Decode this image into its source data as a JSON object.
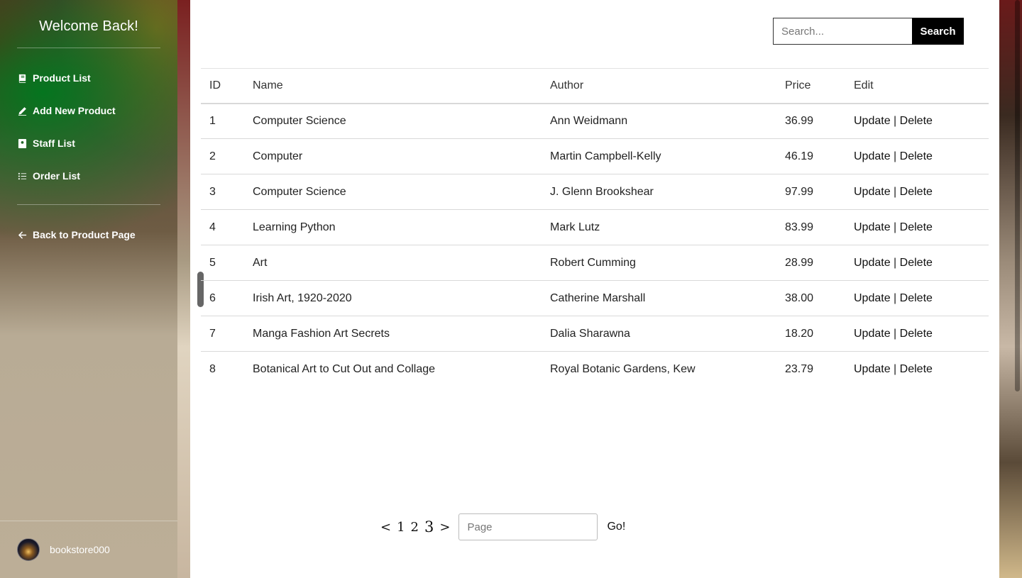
{
  "sidebar": {
    "title": "Welcome Back!",
    "nav": [
      {
        "label": "Product List",
        "icon": "book-icon"
      },
      {
        "label": "Add New Product",
        "icon": "pencil-icon"
      },
      {
        "label": "Staff List",
        "icon": "address-book-icon"
      },
      {
        "label": "Order List",
        "icon": "list-icon"
      }
    ],
    "back_link": {
      "label": "Back to Product Page",
      "icon": "arrow-left-icon"
    },
    "user": {
      "name": "bookstore000"
    }
  },
  "search": {
    "placeholder": "Search...",
    "button_label": "Search"
  },
  "table": {
    "headers": {
      "id": "ID",
      "name": "Name",
      "author": "Author",
      "price": "Price",
      "edit": "Edit"
    },
    "update_label": "Update",
    "separator": "|",
    "delete_label": "Delete",
    "rows": [
      {
        "id": "1",
        "name": "Computer Science",
        "author": "Ann Weidmann",
        "price": "36.99"
      },
      {
        "id": "2",
        "name": "Computer",
        "author": "Martin Campbell-Kelly",
        "price": "46.19"
      },
      {
        "id": "3",
        "name": "Computer Science",
        "author": "J. Glenn Brookshear",
        "price": "97.99"
      },
      {
        "id": "4",
        "name": "Learning Python",
        "author": "Mark Lutz",
        "price": "83.99"
      },
      {
        "id": "5",
        "name": "Art",
        "author": "Robert Cumming",
        "price": "28.99"
      },
      {
        "id": "6",
        "name": "Irish Art, 1920-2020",
        "author": "Catherine Marshall",
        "price": "38.00"
      },
      {
        "id": "7",
        "name": "Manga Fashion Art Secrets",
        "author": "Dalia Sharawna",
        "price": "18.20"
      },
      {
        "id": "8",
        "name": "Botanical Art to Cut Out and Collage",
        "author": "Royal Botanic Gardens, Kew",
        "price": "23.79"
      }
    ]
  },
  "pagination": {
    "prev": "<",
    "pages": [
      "1",
      "2",
      "3"
    ],
    "current_page": "3",
    "next": ">",
    "page_input_placeholder": "Page",
    "go_label": "Go!"
  }
}
